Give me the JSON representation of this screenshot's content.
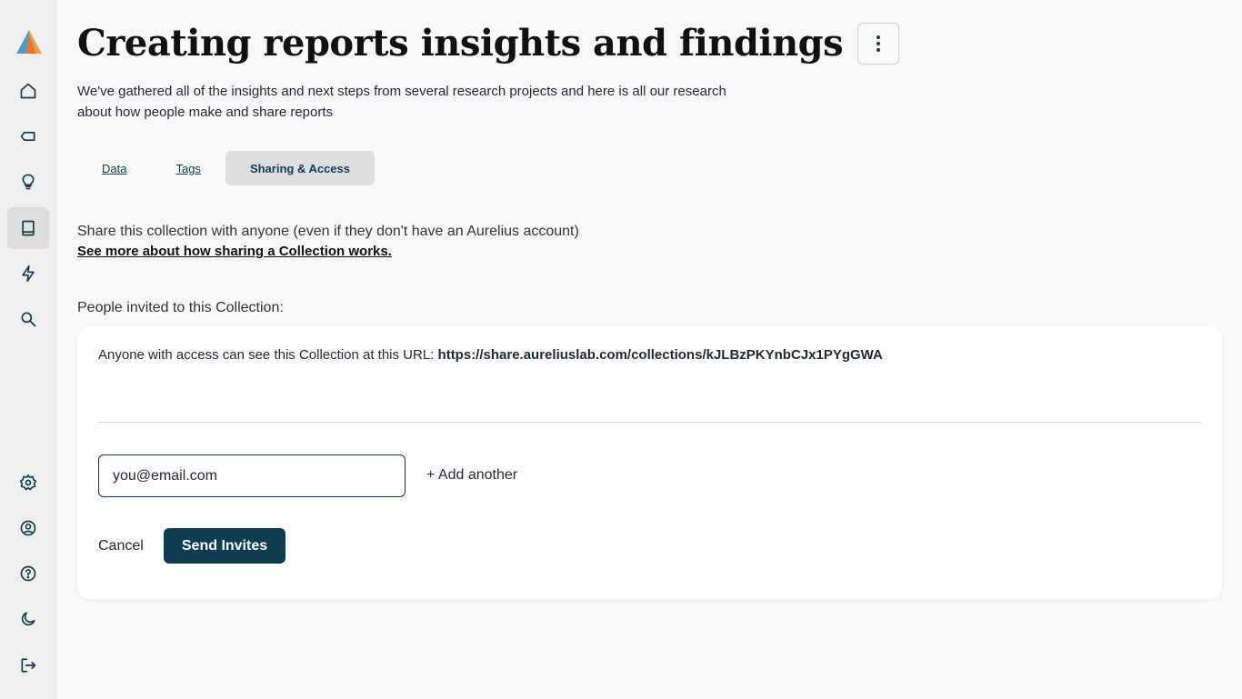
{
  "app": {
    "logo_icon": "aurelius-logo",
    "accent_color": "#0e3d52"
  },
  "sidebar": {
    "items": [
      {
        "name": "home",
        "icon": "home-icon"
      },
      {
        "name": "tags",
        "icon": "tag-icon"
      },
      {
        "name": "insights",
        "icon": "lightbulb-icon"
      },
      {
        "name": "collections",
        "icon": "book-icon",
        "active": true
      },
      {
        "name": "activity",
        "icon": "lightning-icon"
      },
      {
        "name": "search",
        "icon": "search-icon"
      },
      {
        "name": "settings",
        "icon": "gear-icon"
      },
      {
        "name": "account",
        "icon": "user-circle-icon"
      },
      {
        "name": "help",
        "icon": "help-circle-icon"
      },
      {
        "name": "dark-mode",
        "icon": "moon-icon"
      },
      {
        "name": "logout",
        "icon": "logout-icon"
      }
    ]
  },
  "header": {
    "title": "Creating reports insights and findings",
    "subtitle": "We've gathered all of the insights and next steps from several research projects and here is all our research about how people make and share reports"
  },
  "tabs": [
    {
      "label": "Data",
      "active": false
    },
    {
      "label": "Tags",
      "active": false
    },
    {
      "label": "Sharing & Access",
      "active": true
    }
  ],
  "sharing": {
    "description": "Share this collection with anyone (even if they don't have an Aurelius account)",
    "link_text": "See more about how sharing a Collection works.",
    "invited_label": "People invited to this Collection:",
    "url_prefix": "Anyone with access can see this Collection at this URL:",
    "url": "https://share.aureliuslab.com/collections/kJLBzPKYnbCJx1PYgGWA",
    "email_value": "you@email.com",
    "add_another": "+ Add another",
    "cancel_label": "Cancel",
    "send_label": "Send Invites"
  }
}
